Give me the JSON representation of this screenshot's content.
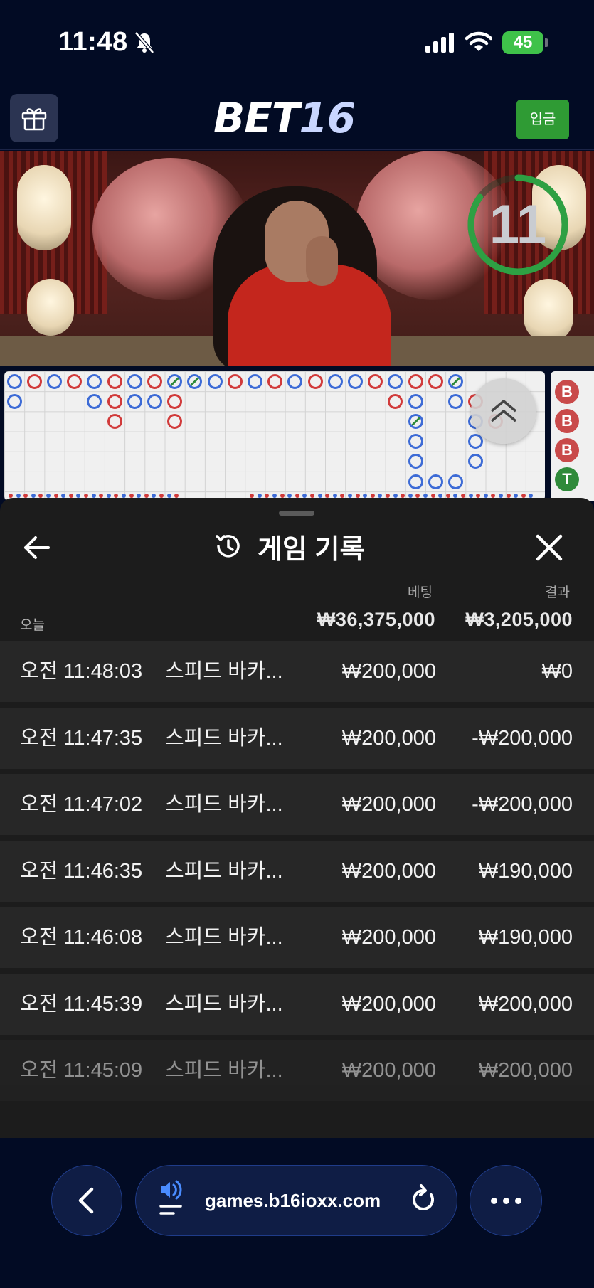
{
  "status_bar": {
    "time": "11:48",
    "battery": "45"
  },
  "header": {
    "logo_main": "BET",
    "logo_num": "16",
    "deposit_label": "입금"
  },
  "timer": {
    "value": "11",
    "progress": 0.85
  },
  "side_road": [
    "B",
    "B",
    "B",
    "T"
  ],
  "history": {
    "title": "게임 기록",
    "bet_col_label": "베팅",
    "result_col_label": "결과",
    "today_label": "오늘",
    "total_bet": "₩36,375,000",
    "total_result": "₩3,205,000",
    "rows": [
      {
        "time": "오전 11:48:03",
        "game": "스피드 바카...",
        "bet": "₩200,000",
        "result": "₩0"
      },
      {
        "time": "오전 11:47:35",
        "game": "스피드 바카...",
        "bet": "₩200,000",
        "result": "-₩200,000"
      },
      {
        "time": "오전 11:47:02",
        "game": "스피드 바카...",
        "bet": "₩200,000",
        "result": "-₩200,000"
      },
      {
        "time": "오전 11:46:35",
        "game": "스피드 바카...",
        "bet": "₩200,000",
        "result": "₩190,000"
      },
      {
        "time": "오전 11:46:08",
        "game": "스피드 바카...",
        "bet": "₩200,000",
        "result": "₩190,000"
      },
      {
        "time": "오전 11:45:39",
        "game": "스피드 바카...",
        "bet": "₩200,000",
        "result": "₩200,000"
      },
      {
        "time": "오전 11:45:09",
        "game": "스피드 바카...",
        "bet": "₩200,000",
        "result": "₩200,000"
      }
    ]
  },
  "browser": {
    "url": "games.b16ioxx.com"
  },
  "colors": {
    "player": "#3d6bd6",
    "banker": "#d13b3b",
    "tie": "#2f8a3a",
    "accent_green": "#2f9b34"
  }
}
